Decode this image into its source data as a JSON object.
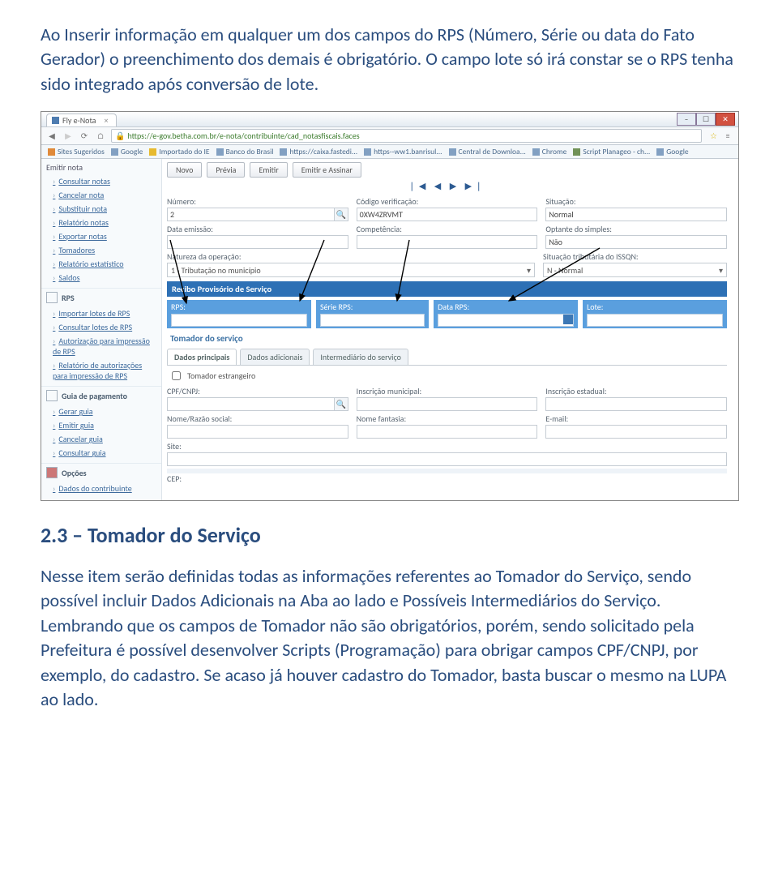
{
  "para1": "Ao Inserir informação em qualquer um dos campos do RPS (Número, Série ou data do Fato Gerador) o preenchimento dos demais é obrigatório. O campo lote só irá constar se o RPS tenha sido integrado após conversão de lote.",
  "heading": "2.3 – Tomador do Serviço",
  "para2": "Nesse item serão definidas todas as informações referentes ao Tomador do Serviço, sendo possível incluir Dados Adicionais na Aba ao lado e Possíveis Intermediários do Serviço. Lembrando que os campos de Tomador não são obrigatórios, porém, sendo solicitado pela Prefeitura é possível desenvolver Scripts (Programação) para obrigar campos CPF/CNPJ, por exemplo, do cadastro. Se acaso já houver cadastro do Tomador, basta buscar o mesmo na LUPA ao lado.",
  "browser": {
    "tab_title": "Fly e-Nota",
    "url": "https://e-gov.betha.com.br/e-nota/contribuinte/cad_notasfiscais.faces",
    "bookmarks": [
      "Sites Sugeridos",
      "Google",
      "Importado do IE",
      "Banco do Brasil",
      "https://caixa.fastedi...",
      "https--ww1.banrisul...",
      "Central de Downloa...",
      "Chrome",
      "Script Planageo - ch...",
      "Google"
    ]
  },
  "sidebar": {
    "top_items": [
      "Emitir nota",
      "Consultar notas",
      "Cancelar nota",
      "Substituir nota",
      "Relatório notas",
      "Exportar notas",
      "Tomadores",
      "Relatório estatístico",
      "Saldos"
    ],
    "group_rps": "RPS",
    "rps_items": [
      "Importar lotes de RPS",
      "Consultar lotes de RPS",
      "Autorização para impressão de RPS",
      "Relatório de autorizações para impressão de RPS"
    ],
    "group_guia": "Guia de pagamento",
    "guia_items": [
      "Gerar guia",
      "Emitir guia",
      "Cancelar guia",
      "Consultar guia"
    ],
    "group_opcoes": "Opções",
    "opcoes_items": [
      "Dados do contribuinte"
    ]
  },
  "form": {
    "toolbar": {
      "novo": "Novo",
      "previa": "Prévia",
      "emitir": "Emitir",
      "emitir_assinar": "Emitir e Assinar"
    },
    "pager": "❘◀ ◀ ▶ ▶❘",
    "fields": {
      "numero_label": "Número:",
      "numero_value": "2",
      "codigo_label": "Código verificação:",
      "codigo_value": "0XW4ZRVMT",
      "situacao_label": "Situação:",
      "situacao_value": "Normal",
      "data_emissao_label": "Data emissão:",
      "competencia_label": "Competência:",
      "optante_label": "Optante do simples:",
      "optante_value": "Não",
      "natureza_label": "Natureza da operação:",
      "natureza_value": "1 - Tributação no município",
      "sit_trib_label": "Situação tributária do ISSQN:",
      "sit_trib_value": "N - Normal"
    },
    "recibo_header": "Recibo Provisório de Serviço",
    "rps": {
      "rps": "RPS:",
      "serie": "Série RPS:",
      "data": "Data RPS:",
      "lote": "Lote:"
    },
    "tomador_header": "Tomador do serviço",
    "tabs": {
      "principais": "Dados principais",
      "adicionais": "Dados adicionais",
      "inter": "Intermediário do serviço"
    },
    "tomador": {
      "estrangeiro": "Tomador estrangeiro",
      "cpf_label": "CPF/CNPJ:",
      "insc_mun_label": "Inscrição municipal:",
      "insc_est_label": "Inscrição estadual:",
      "nome_label": "Nome/Razão social:",
      "fantasia_label": "Nome fantasia:",
      "email_label": "E-mail:",
      "site_label": "Site:",
      "cep_label": "CEP:"
    }
  }
}
